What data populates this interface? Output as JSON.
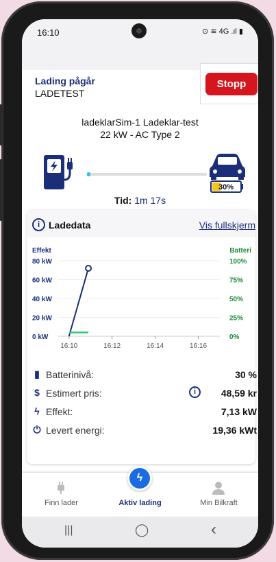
{
  "status_bar": {
    "time": "16:10",
    "icons": "⊙ ≋ 4G .ıl ▮"
  },
  "header": {
    "title": "Lading pågår",
    "subtitle": "LADETEST",
    "stop_label": "Stopp"
  },
  "charger": {
    "name": "ladeklarSim-1 Ladeklar-test",
    "spec": "22 kW - AC Type 2"
  },
  "session": {
    "time_label": "Tid:",
    "time_value": "1m 17s",
    "battery_percent": 30,
    "battery_badge": "30%",
    "progress": 0.03
  },
  "ladedata": {
    "title": "Ladedata",
    "fullscreen_link": "Vis fullskjerm",
    "info_icon": "info-icon"
  },
  "chart_data": {
    "type": "line",
    "ylabel_left": "Effekt",
    "ylabel_right": "Batteri",
    "left_ticks": [
      "80 kW",
      "60 kW",
      "40 kW",
      "20 kW",
      "0 kW"
    ],
    "right_ticks": [
      "100%",
      "75%",
      "50%",
      "25%",
      "0%"
    ],
    "x_ticks": [
      "16:10",
      "16:12",
      "16:14",
      "16:16"
    ],
    "ylim_left": [
      0,
      80
    ],
    "ylim_right": [
      0,
      100
    ],
    "series": [
      {
        "color": "#1a2e7a",
        "x_minutes": [
          0.0,
          0.9
        ],
        "values": [
          0,
          72
        ]
      },
      {
        "color": "#2ecc71",
        "x_minutes": [
          0.0,
          0.9
        ],
        "values": [
          4,
          4
        ]
      }
    ],
    "colors": {
      "left_axis": "#1a2e7a",
      "right_axis": "#1b8a3a"
    }
  },
  "stats": [
    {
      "icon": "battery-icon",
      "glyph": "▮",
      "label": "Batterinivå:",
      "value": "30 %"
    },
    {
      "icon": "dollar-icon",
      "glyph": "$",
      "label": "Estimert pris:",
      "value": "48,59 kr"
    },
    {
      "icon": "bolt-icon",
      "glyph": "ϟ",
      "label": "Effekt:",
      "value": "7,13 kW"
    },
    {
      "icon": "plug-icon",
      "glyph": "⏻",
      "label": "Levert energi:",
      "value": "19,36 kWt"
    }
  ],
  "tabs": [
    {
      "label": "Finn lader",
      "icon": "plug-icon"
    },
    {
      "label": "Aktiv lading",
      "icon": "bolt-icon"
    },
    {
      "label": "Min Bilkraft",
      "icon": "person-icon"
    }
  ],
  "nav": {
    "recents": "|||",
    "home": "◯",
    "back": "‹"
  }
}
